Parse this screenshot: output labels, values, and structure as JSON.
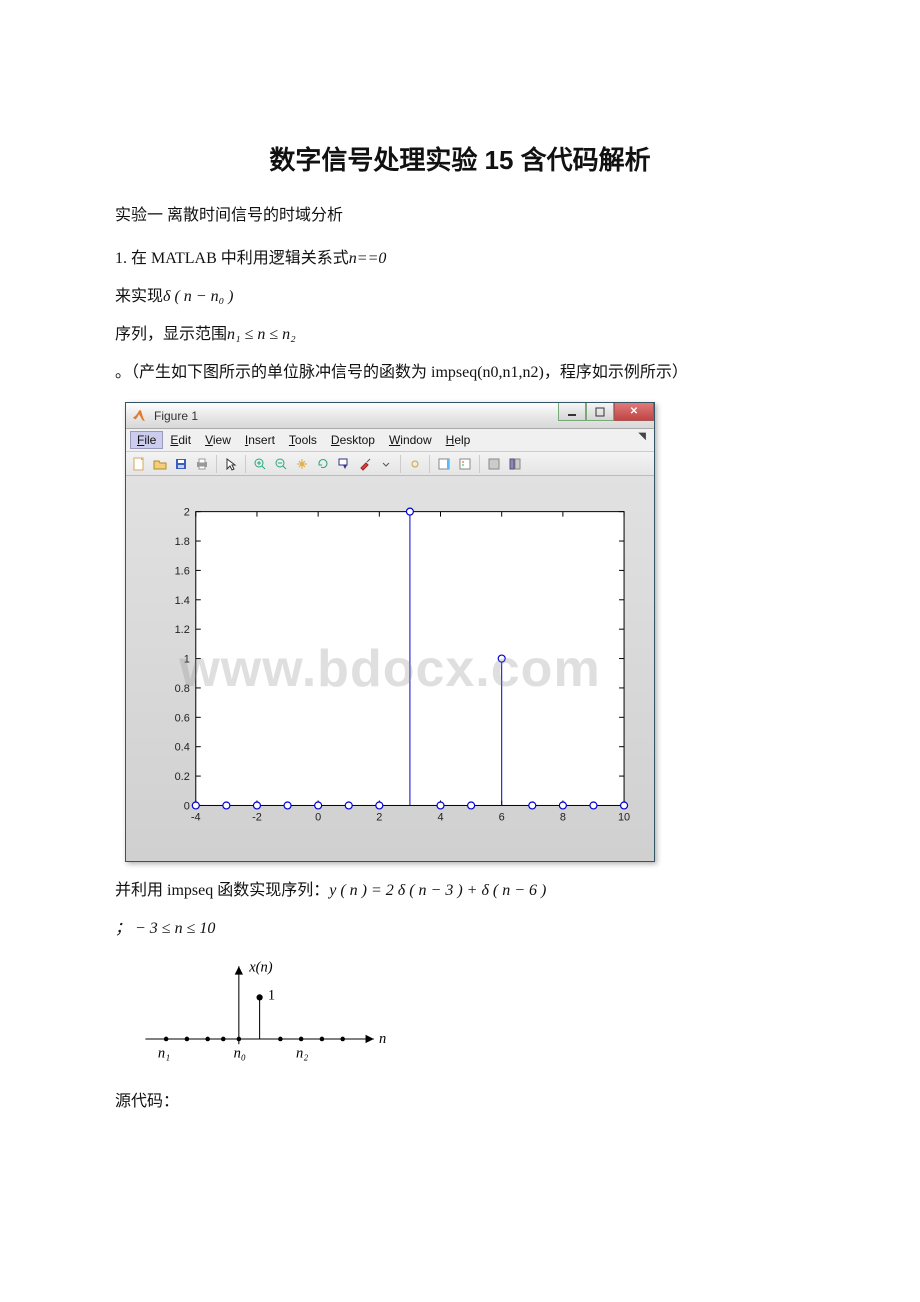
{
  "doc": {
    "title": "数字信号处理实验 15 含代码解析",
    "subtitle": "实验一 离散时间信号的时域分析",
    "p1_prefix": "1. 在 MATLAB 中利用逻辑关系式",
    "p1_math": "n==0",
    "p2_prefix": "来实现",
    "p2_math": "δ ( n − n₀ )",
    "p3_prefix": "序列，显示范围",
    "p3_math": "n₁ ≤ n ≤ n₂",
    "p4": "。（产生如下图所示的单位脉冲信号的函数为 impseq(n0,n1,n2)，程序如示例所示）",
    "p5_prefix": "并利用 impseq 函数实现序列：",
    "p5_math": "y ( n ) = 2 δ ( n − 3 ) + δ ( n − 6 )",
    "p6_math": "； − 3 ≤ n ≤ 10",
    "p7": "源代码：",
    "sketch": {
      "y_label": "x(n)",
      "x_label": "n",
      "one_label": "1",
      "n1_label": "n₁",
      "n0_label": "n₀",
      "n2_label": "n₂"
    }
  },
  "figure": {
    "window_title": "Figure 1",
    "menus": [
      "File",
      "Edit",
      "View",
      "Insert",
      "Tools",
      "Desktop",
      "Window",
      "Help"
    ],
    "watermark": "www.bdocx.com"
  },
  "chart_data": {
    "type": "bar",
    "title": "",
    "xlabel": "",
    "ylabel": "",
    "xlim": [
      -4,
      10
    ],
    "ylim": [
      0,
      2
    ],
    "x_ticks": [
      -4,
      -2,
      0,
      2,
      4,
      6,
      8,
      10
    ],
    "y_ticks": [
      0,
      0.2,
      0.4,
      0.6,
      0.8,
      1,
      1.2,
      1.4,
      1.6,
      1.8,
      2
    ],
    "categories": [
      -4,
      -3,
      -2,
      -1,
      0,
      1,
      2,
      3,
      4,
      5,
      6,
      7,
      8,
      9,
      10
    ],
    "values": [
      0,
      0,
      0,
      0,
      0,
      0,
      0,
      2,
      0,
      0,
      1,
      0,
      0,
      0,
      0
    ]
  }
}
